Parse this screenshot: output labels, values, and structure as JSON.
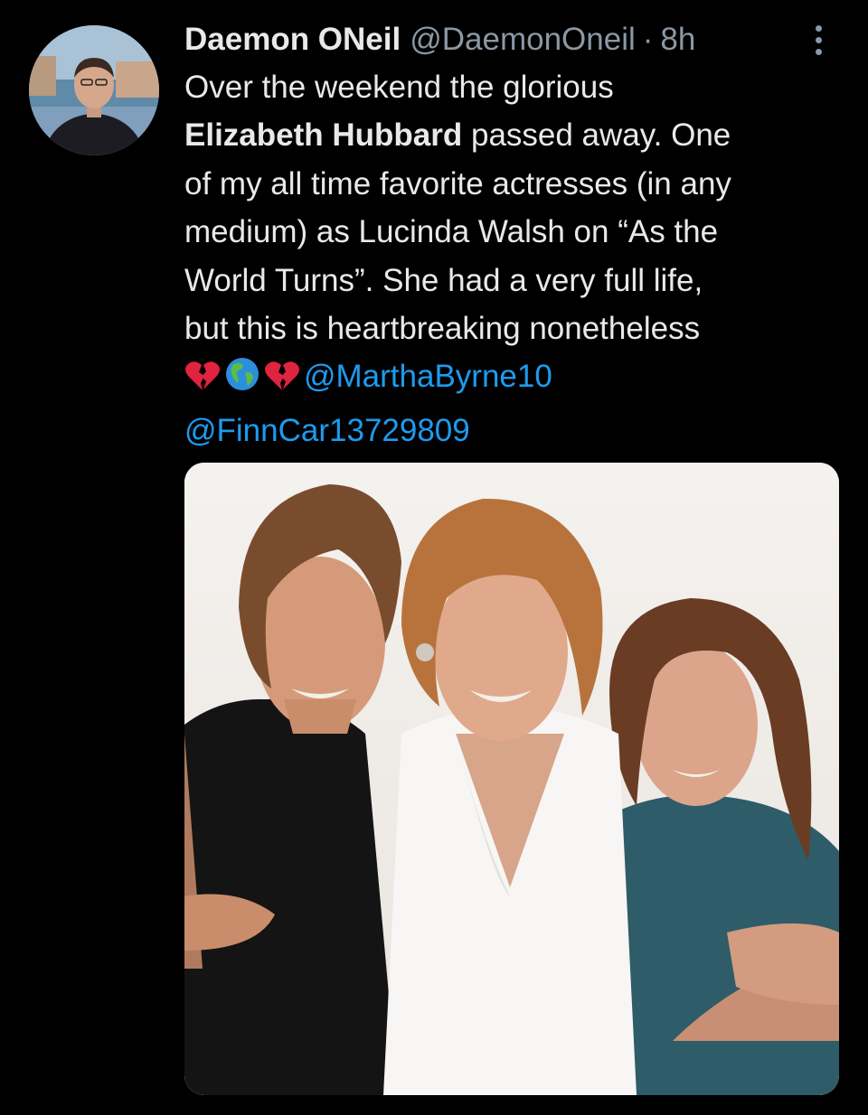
{
  "tweet": {
    "author": {
      "display_name": "Daemon ONeil",
      "handle": "@DaemonOneil",
      "avatar_icon": "user-avatar"
    },
    "separator": "·",
    "timestamp": "8h",
    "more_icon": "more-vertical-icon",
    "text": {
      "line1": "Over the weekend the glorious",
      "line2_bold": "Elizabeth Hubbard",
      "line2_rest": " passed away.  One",
      "line3": "of my all time favorite actresses (in any",
      "line4": "medium) as Lucinda Walsh on “As the",
      "line5": "World Turns”.  She had a very full life,",
      "line6": "but this is heartbreaking nonetheless",
      "emojis": [
        "broken-heart-icon",
        "globe-americas-icon",
        "broken-heart-icon"
      ],
      "mention1": "@MarthaByrne10",
      "mention2": "@FinnCar13729809"
    },
    "media": {
      "type": "photo",
      "icon": "photo-of-three-women"
    }
  },
  "colors": {
    "background": "#000000",
    "text": "#e7e9ea",
    "secondary": "#8b98a5",
    "link": "#1d9bf0",
    "broken_heart": "#e0233f"
  }
}
